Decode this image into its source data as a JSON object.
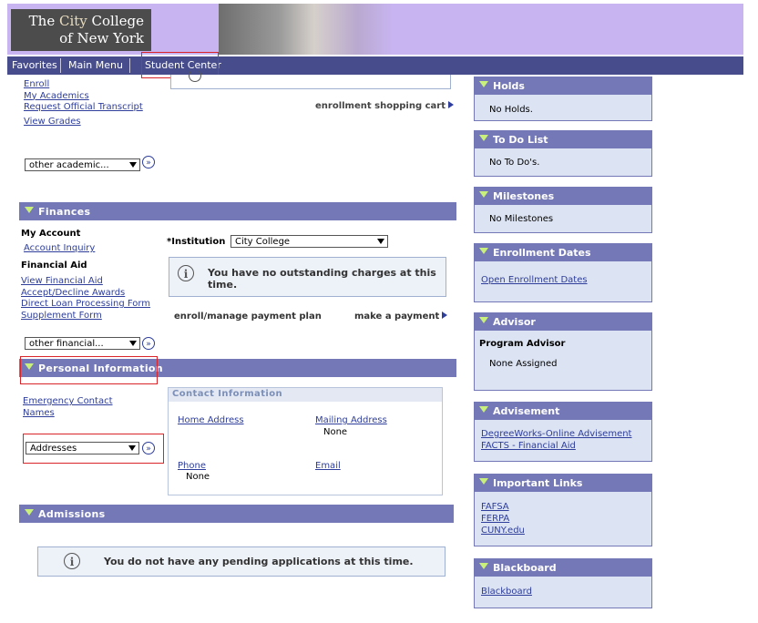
{
  "header": {
    "logo_line1_a": "The ",
    "logo_line1_b": "City",
    "logo_line1_c": " College",
    "logo_line2": "of New York"
  },
  "nav": {
    "favorites": "Favorites",
    "main_menu": "Main Menu",
    "student_center": "Student Center"
  },
  "academics": {
    "links": [
      "Enroll",
      "My Academics",
      "Request Official Transcript",
      "View Grades"
    ],
    "shopping_cart": "enrollment shopping cart",
    "select": "other academic..."
  },
  "finances": {
    "title": "Finances",
    "my_account": "My Account",
    "account_inquiry": "Account Inquiry",
    "financial_aid": "Financial Aid",
    "aid_links": [
      "View Financial Aid",
      "Accept/Decline Awards",
      "Direct Loan Processing Form",
      "Supplement Form"
    ],
    "select": "other financial...",
    "institution_label": "*Institution",
    "institution_value": "City College",
    "charges_msg": "You have no outstanding charges at this time.",
    "payment_plan": "enroll/manage payment plan",
    "make_payment": "make a payment"
  },
  "personal": {
    "title": "Personal Information",
    "links": [
      "Emergency Contact",
      "Names"
    ],
    "select": "Addresses",
    "contact_title": "Contact Information",
    "home_address": "Home Address",
    "mailing_address": "Mailing Address",
    "mailing_value": "None",
    "phone": "Phone",
    "phone_value": "None",
    "email": "Email"
  },
  "admissions": {
    "title": "Admissions",
    "msg": "You do not have any pending applications at this time."
  },
  "right": {
    "holds": {
      "title": "Holds",
      "text": "No Holds."
    },
    "todo": {
      "title": "To Do List",
      "text": "No To Do's."
    },
    "milestones": {
      "title": "Milestones",
      "text": "No Milestones"
    },
    "enrollment_dates": {
      "title": "Enrollment Dates",
      "link": "Open Enrollment Dates"
    },
    "advisor": {
      "title": "Advisor",
      "label": "Program Advisor",
      "text": "None Assigned"
    },
    "advisement": {
      "title": "Advisement",
      "links": [
        "DegreeWorks-Online Advisement",
        "FACTS - Financial Aid"
      ]
    },
    "important_links": {
      "title": "Important Links",
      "links": [
        "FAFSA",
        "FERPA",
        "CUNY.edu"
      ]
    },
    "blackboard": {
      "title": "Blackboard",
      "link": "Blackboard"
    }
  }
}
